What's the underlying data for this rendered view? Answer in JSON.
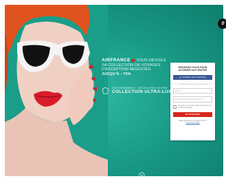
{
  "promo": {
    "brand": "AIRFRANCE",
    "line1": "VOUS DÉVOILE",
    "line2": "SA COLLECTION DE VOYAGES",
    "line3": "D'EXCEPTION NÉGOCIÉS",
    "line4": "JUSQU'À - 70%"
  },
  "collection": {
    "line1": "EN ÉVÈNEMENT · DÉCOUVREZ NOTRE",
    "line2": "COLLECTION ULTRA-LUXE"
  },
  "card": {
    "title_line1": "INSCRIVEZ-VOUS POUR",
    "title_line2": "ACCÉDER AUX VENTES",
    "facebook_label": "Inscription avec Facebook",
    "or_text": "ou inscrivez-vous avec votre email",
    "email_placeholder": "Email",
    "password_placeholder": "Mot de passe (6 caractères min.)",
    "newsletter_text": "J'accepte de recevoir les offres exclusives et les conditions générales",
    "submit_label": "JE M'INSCRIS",
    "login_prompt": "Déjà membre de Voyage Privé ?",
    "login_link": "Connectez-vous"
  },
  "badge": {
    "text": "0"
  },
  "colors": {
    "background": "#1a9d89",
    "brand_red": "#d7261e",
    "facebook_blue": "#3b5998"
  }
}
